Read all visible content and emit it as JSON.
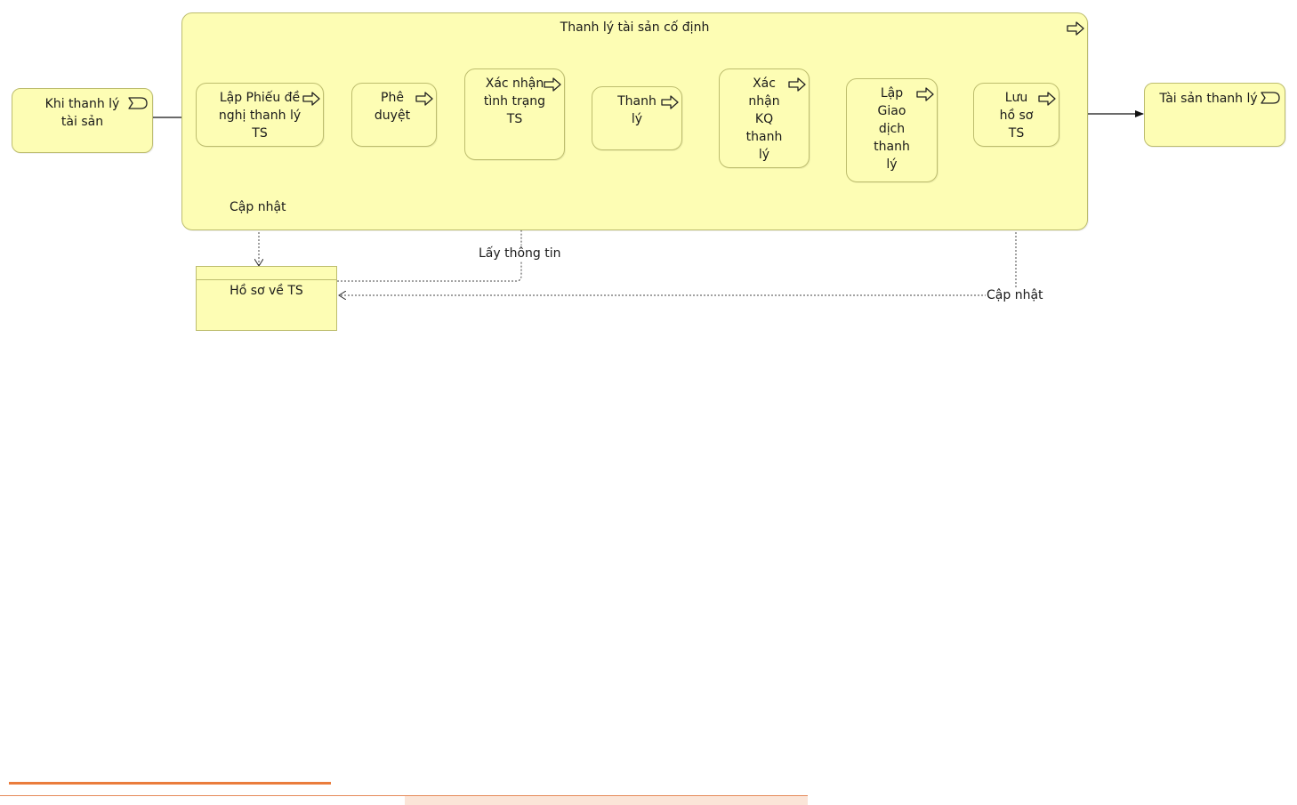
{
  "group": {
    "title": "Thanh lý tài sản cố định"
  },
  "event_start": {
    "label": "Khi thanh lý tài sản"
  },
  "event_end": {
    "label": "Tài sản thanh lý"
  },
  "steps": [
    {
      "label": "Lập Phiếu đề nghị thanh lý TS"
    },
    {
      "label": "Phê duyệt"
    },
    {
      "label": "Xác nhận tình trạng TS"
    },
    {
      "label": "Thanh lý"
    },
    {
      "label": "Xác nhận KQ thanh lý"
    },
    {
      "label": "Lập Giao dịch thanh lý"
    },
    {
      "label": "Lưu hồ sơ TS"
    }
  ],
  "data_object": {
    "label": "Hồ sơ về TS"
  },
  "edge_labels": {
    "update_1": "Cập nhật",
    "get_info": "Lấy thông tin",
    "update_2": "Cập nhật"
  },
  "colors": {
    "node_fill": "#fdfdb4",
    "node_border": "#bdbd6e",
    "footer_orange": "#ea7c3c"
  },
  "icons": {
    "process": "process-arrow-icon",
    "event": "event-flag-icon"
  }
}
